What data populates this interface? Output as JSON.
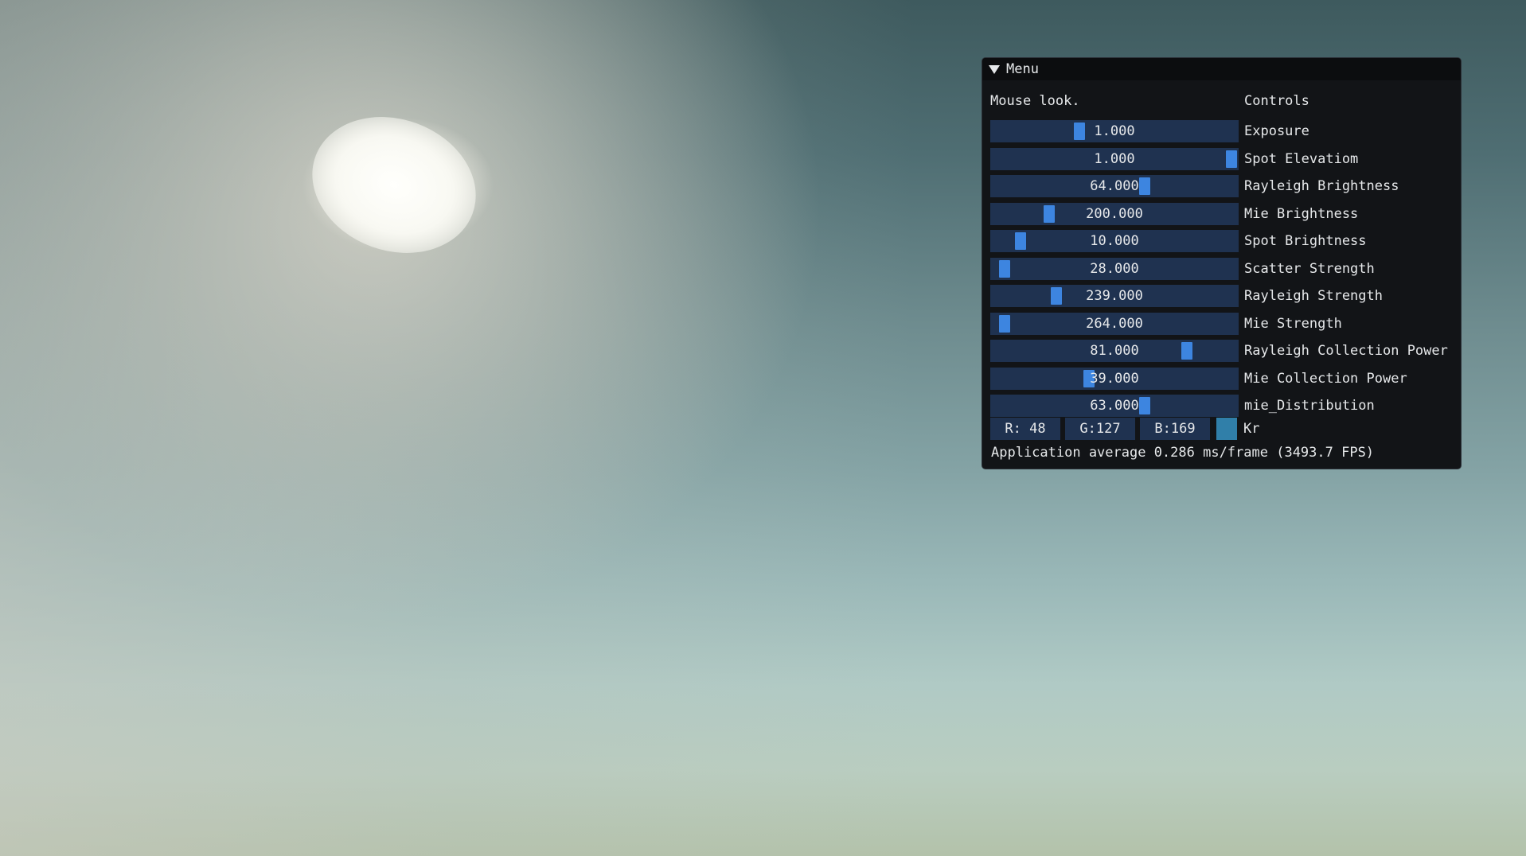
{
  "menu": {
    "title": "Menu",
    "hint": "Mouse look.",
    "controls_header": "Controls",
    "sliders": [
      {
        "value": "1.000",
        "label": "Exposure",
        "level": 0.35
      },
      {
        "value": "1.000",
        "label": "Spot Elevatiom",
        "level": 1.0
      },
      {
        "value": "64.000",
        "label": "Rayleigh Brightness",
        "level": 0.63
      },
      {
        "value": "200.000",
        "label": "Mie Brightness",
        "level": 0.22
      },
      {
        "value": "10.000",
        "label": "Spot Brightness",
        "level": 0.1
      },
      {
        "value": "28.000",
        "label": "Scatter Strength",
        "level": 0.03
      },
      {
        "value": "239.000",
        "label": "Rayleigh Strength",
        "level": 0.25
      },
      {
        "value": "264.000",
        "label": "Mie Strength",
        "level": 0.03
      },
      {
        "value": "81.000",
        "label": "Rayleigh Collection Power",
        "level": 0.81
      },
      {
        "value": "39.000",
        "label": "Mie Collection Power",
        "level": 0.39
      },
      {
        "value": "63.000",
        "label": "mie_Distribution",
        "level": 0.63
      }
    ],
    "color": {
      "r": "R: 48",
      "g": "G:127",
      "b": "B:169",
      "label": "Kr",
      "swatch": "#307fa9"
    },
    "footer": "Application average 0.286 ms/frame (3493.7 FPS)"
  },
  "colors": {
    "window_bg": "#121417",
    "frame_bg": "#1f3250",
    "slider_grab": "#3d85e0"
  }
}
